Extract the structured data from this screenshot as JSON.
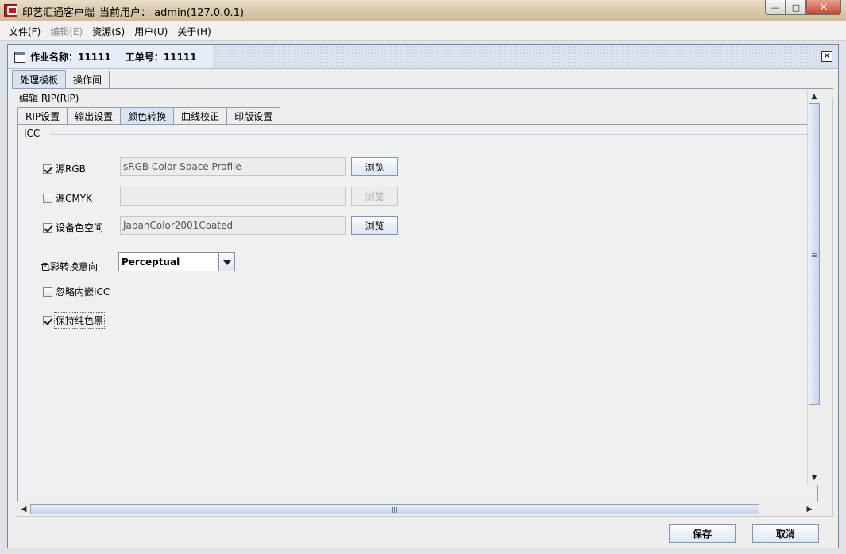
{
  "window": {
    "app_title": "印艺汇通客户端",
    "user_info": "当前用户： admin(127.0.0.1)",
    "minimize": "—",
    "maximize": "□",
    "close": "✕"
  },
  "menu": [
    {
      "label": "文件(F)",
      "enabled": true
    },
    {
      "label": "编辑(E)",
      "enabled": false
    },
    {
      "label": "资源(S)",
      "enabled": true
    },
    {
      "label": "用户(U)",
      "enabled": true
    },
    {
      "label": "关于(H)",
      "enabled": true
    }
  ],
  "frame": {
    "job_name_label": "作业名称：",
    "job_name_value": "11111",
    "order_label": "工单号：",
    "order_value": "11111",
    "close": "✕"
  },
  "outer_tabs": [
    {
      "label": "处理模板",
      "active": true
    },
    {
      "label": "操作间",
      "active": false
    }
  ],
  "edit_title": "编辑 RIP(RIP)",
  "inner_tabs": [
    {
      "label": "RIP设置",
      "active": false
    },
    {
      "label": "输出设置",
      "active": false
    },
    {
      "label": "颜色转换",
      "active": true
    },
    {
      "label": "曲线校正",
      "active": false
    },
    {
      "label": "印版设置",
      "active": false
    }
  ],
  "icc": {
    "group_title": "ICC",
    "rows": [
      {
        "label": "源RGB",
        "checked": true,
        "value": "sRGB Color Space Profile",
        "button": "浏览",
        "button_enabled": true
      },
      {
        "label": "源CMYK",
        "checked": false,
        "value": "",
        "button": "浏览",
        "button_enabled": false
      },
      {
        "label": "设备色空间",
        "checked": true,
        "value": "JapanColor2001Coated",
        "button": "浏览",
        "button_enabled": true
      }
    ],
    "intent_label": "色彩转换意向",
    "intent_value": "Perceptual",
    "ignore_icc": {
      "label": "忽略内嵌ICC",
      "checked": false
    },
    "keep_black": {
      "label": "保持纯色黑",
      "checked": true
    }
  },
  "scroll": {
    "up": "▲",
    "down": "▼",
    "left": "◀",
    "right": "▶"
  },
  "footer": {
    "save": "保存",
    "cancel": "取消"
  },
  "colors": {
    "accent": "#8d9db6",
    "title_bar": "#d8c8a8",
    "frame_border": "#6e85a8"
  }
}
